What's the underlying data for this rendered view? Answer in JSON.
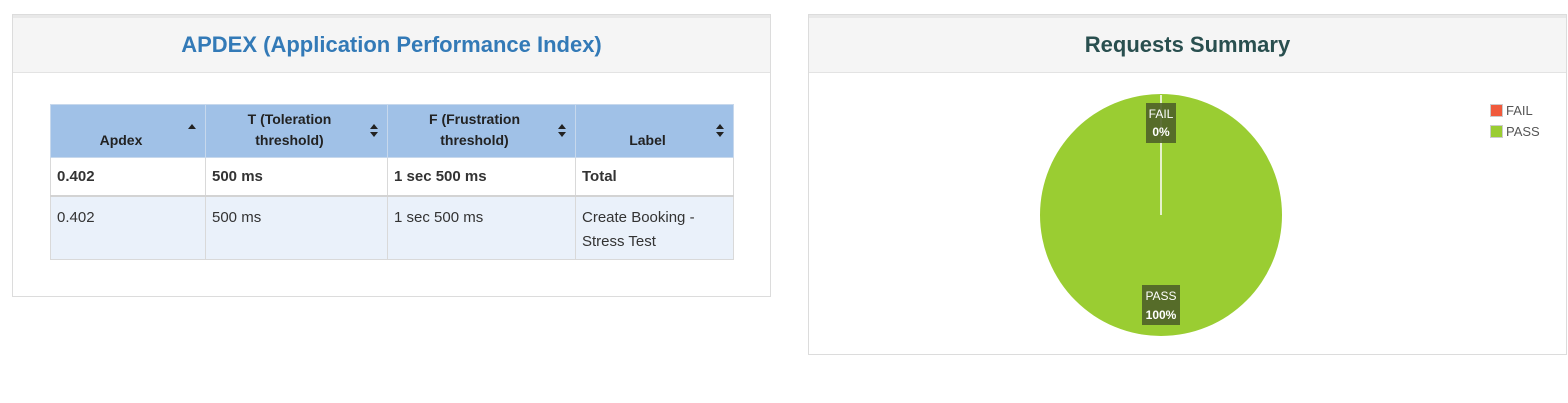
{
  "apdex": {
    "title": "APDEX (Application Performance Index)",
    "columns": [
      "Apdex",
      "T (Toleration threshold)",
      "F (Frustration threshold)",
      "Label"
    ],
    "total": {
      "apdex": "0.402",
      "t": "500 ms",
      "f": "1 sec 500 ms",
      "label": "Total"
    },
    "rows": [
      {
        "apdex": "0.402",
        "t": "500 ms",
        "f": "1 sec 500 ms",
        "label": "Create Booking - Stress Test"
      }
    ]
  },
  "summary": {
    "title": "Requests Summary",
    "legend": [
      {
        "label": "FAIL",
        "color": "#f05a3c"
      },
      {
        "label": "PASS",
        "color": "#9acd32"
      }
    ],
    "pie_labels": {
      "fail_name": "FAIL",
      "fail_pct": "0%",
      "pass_name": "PASS",
      "pass_pct": "100%"
    }
  },
  "chart_data": {
    "type": "pie",
    "title": "Requests Summary",
    "categories": [
      "FAIL",
      "PASS"
    ],
    "values": [
      0,
      100
    ],
    "colors": [
      "#f05a3c",
      "#9acd32"
    ],
    "legend_position": "top-right"
  }
}
